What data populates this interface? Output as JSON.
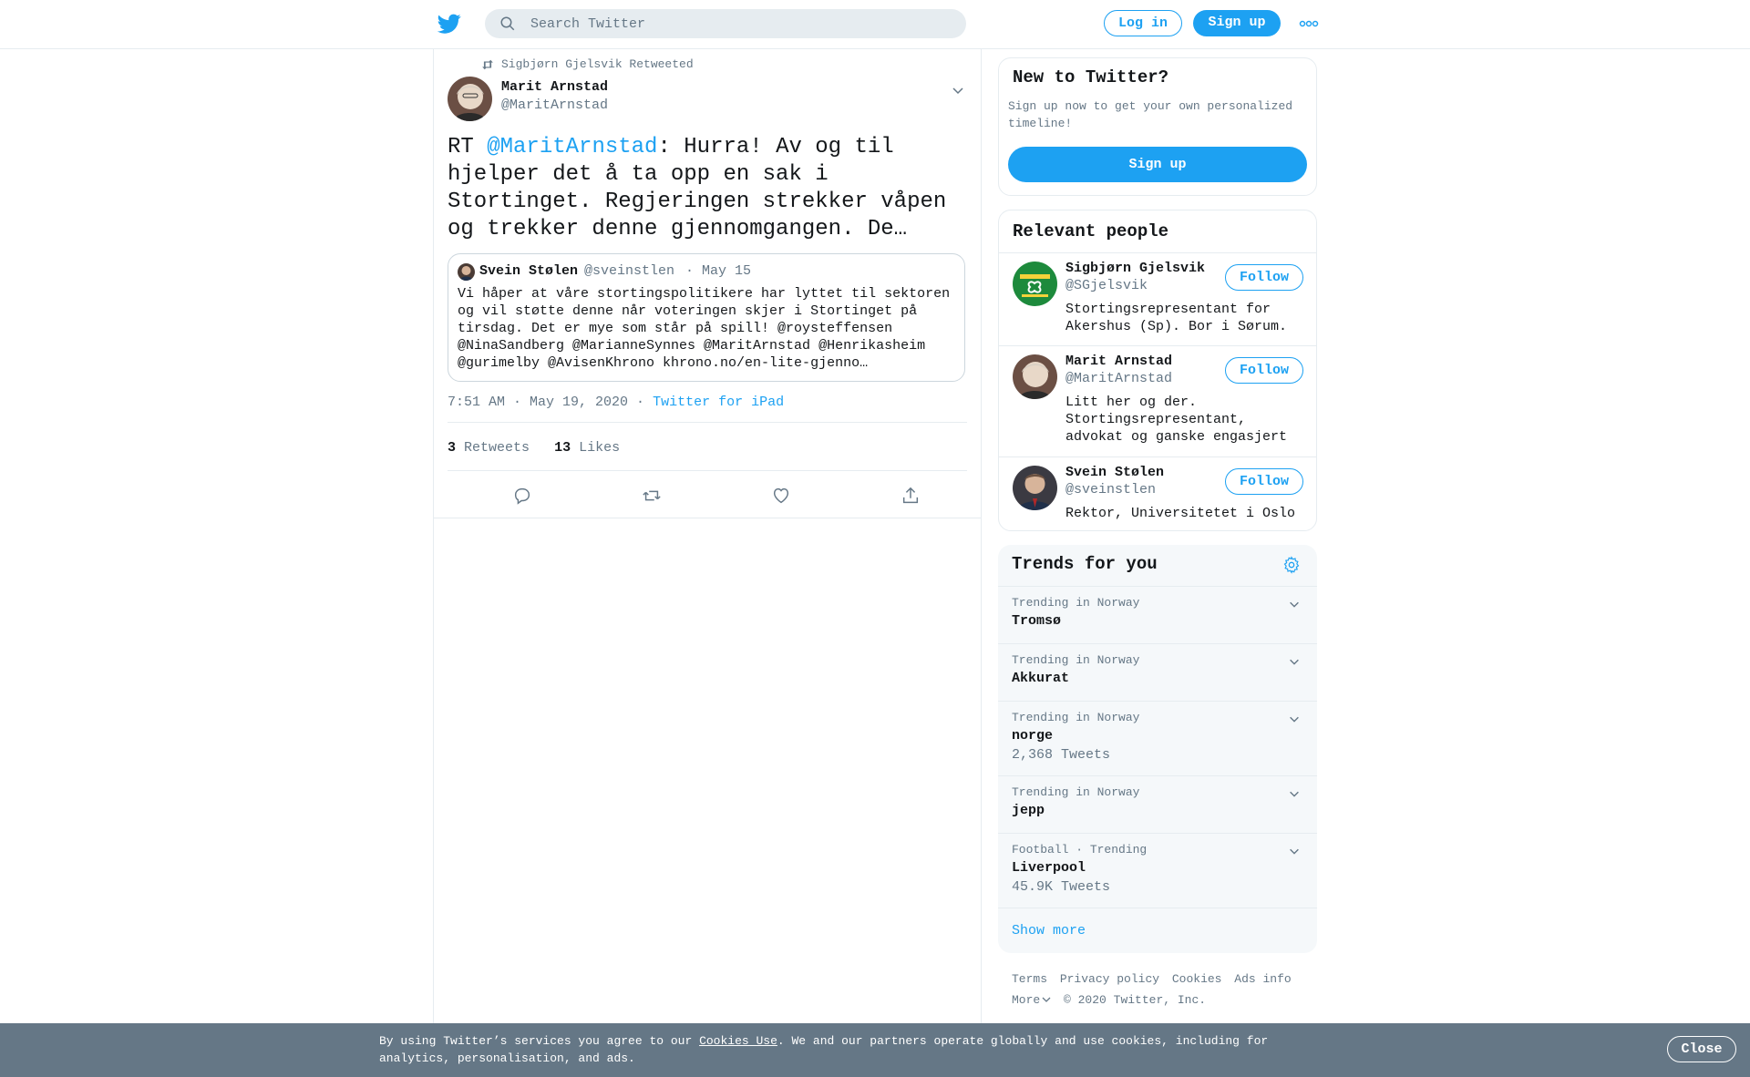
{
  "topbar": {
    "search_placeholder": "Search Twitter",
    "login_label": "Log in",
    "signup_label": "Sign up"
  },
  "tweet": {
    "retweeted_by": "Sigbjørn Gjelsvik Retweeted",
    "author_name": "Marit Arnstad",
    "author_handle": "@MaritArnstad",
    "text_prefix": "RT ",
    "text_mention": "@MaritArnstad",
    "text_body": ": Hurra! Av og til hjelper det å ta opp en sak i Stortinget. Regjeringen strekker våpen og trekker denne gjennomgangen. De…",
    "quote": {
      "name": "Svein Stølen",
      "handle": "@sveinstlen",
      "date": "· May 15",
      "text": "Vi håper at våre stortingspolitikere har lyttet til sektoren og vil støtte denne når voteringen skjer i Stortinget på tirsdag. Det er mye som står på spill! @roysteffensen @NinaSandberg @MarianneSynnes @MaritArnstad @Henrikasheim @gurimelby @AvisenKhrono khrono.no/en-lite-gjenno…"
    },
    "timestamp": "7:51 AM · May 19, 2020 ·",
    "source": "Twitter for iPad",
    "retweets_count": "3",
    "retweets_label": "Retweets",
    "likes_count": "13",
    "likes_label": "Likes"
  },
  "sidebar": {
    "new_to_twitter": {
      "title": "New to Twitter?",
      "desc": "Sign up now to get your own personalized timeline!",
      "button": "Sign up"
    },
    "relevant": {
      "title": "Relevant people",
      "follow_label": "Follow",
      "people": [
        {
          "name": "Sigbjørn Gjelsvik",
          "handle": "@SGjelsvik",
          "bio": "Stortingsrepresentant for Akershus (Sp). Bor i Sørum."
        },
        {
          "name": "Marit Arnstad",
          "handle": "@MaritArnstad",
          "bio": "Litt her og der. Stortingsrepresentant, advokat og ganske engasjert"
        },
        {
          "name": "Svein Stølen",
          "handle": "@sveinstlen",
          "bio": "Rektor, Universitetet i Oslo"
        }
      ]
    },
    "trends": {
      "title": "Trends for you",
      "items": [
        {
          "context": "Trending in Norway",
          "name": "Tromsø",
          "count": ""
        },
        {
          "context": "Trending in Norway",
          "name": "Akkurat",
          "count": ""
        },
        {
          "context": "Trending in Norway",
          "name": "norge",
          "count": "2,368 Tweets"
        },
        {
          "context": "Trending in Norway",
          "name": "jepp",
          "count": ""
        },
        {
          "context": "Football · Trending",
          "name": "Liverpool",
          "count": "45.9K Tweets"
        }
      ],
      "show_more": "Show more"
    },
    "footer": {
      "terms": "Terms",
      "privacy": "Privacy policy",
      "cookies": "Cookies",
      "ads": "Ads info",
      "more": "More",
      "copyright": "© 2020 Twitter, Inc."
    }
  },
  "cookie_bar": {
    "text_before": "By using Twitter’s services you agree to our ",
    "link": "Cookies Use",
    "text_after": ". We and our partners operate globally and use cookies, including for analytics, personalisation, and ads.",
    "close": "Close"
  },
  "colors": {
    "accent": "#1da1f2",
    "text": "#14171a",
    "muted": "#657786",
    "border": "#e6ecf0",
    "cookie_bg": "#657786"
  }
}
